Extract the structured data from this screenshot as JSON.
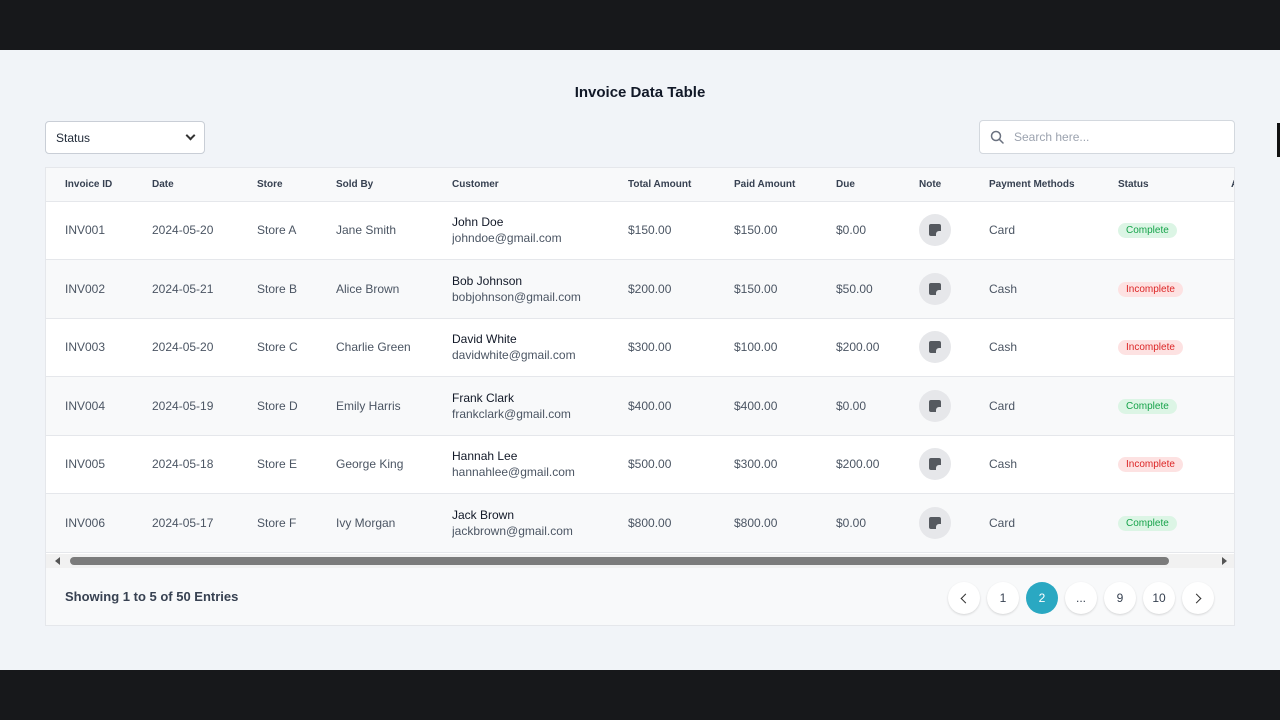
{
  "page": {
    "title": "Invoice Data Table"
  },
  "filters": {
    "status_select": "Status",
    "search_placeholder": "Search here..."
  },
  "table": {
    "columns": [
      "Invoice ID",
      "Date",
      "Store",
      "Sold By",
      "Customer",
      "Total Amount",
      "Paid Amount",
      "Due",
      "Note",
      "Payment Methods",
      "Status",
      "A"
    ],
    "rows": [
      {
        "id": "INV001",
        "date": "2024-05-20",
        "store": "Store A",
        "sold_by": "Jane Smith",
        "customer_name": "John Doe",
        "customer_email": "johndoe@gmail.com",
        "total": "$150.00",
        "paid": "$150.00",
        "due": "$0.00",
        "method": "Card",
        "status": "Complete"
      },
      {
        "id": "INV002",
        "date": "2024-05-21",
        "store": "Store B",
        "sold_by": "Alice Brown",
        "customer_name": "Bob Johnson",
        "customer_email": "bobjohnson@gmail.com",
        "total": "$200.00",
        "paid": "$150.00",
        "due": "$50.00",
        "method": "Cash",
        "status": "Incomplete"
      },
      {
        "id": "INV003",
        "date": "2024-05-20",
        "store": "Store C",
        "sold_by": "Charlie Green",
        "customer_name": "David White",
        "customer_email": "davidwhite@gmail.com",
        "total": "$300.00",
        "paid": "$100.00",
        "due": "$200.00",
        "method": "Cash",
        "status": "Incomplete"
      },
      {
        "id": "INV004",
        "date": "2024-05-19",
        "store": "Store D",
        "sold_by": "Emily Harris",
        "customer_name": "Frank Clark",
        "customer_email": "frankclark@gmail.com",
        "total": "$400.00",
        "paid": "$400.00",
        "due": "$0.00",
        "method": "Card",
        "status": "Complete"
      },
      {
        "id": "INV005",
        "date": "2024-05-18",
        "store": "Store E",
        "sold_by": "George King",
        "customer_name": "Hannah Lee",
        "customer_email": "hannahlee@gmail.com",
        "total": "$500.00",
        "paid": "$300.00",
        "due": "$200.00",
        "method": "Cash",
        "status": "Incomplete"
      },
      {
        "id": "INV006",
        "date": "2024-05-17",
        "store": "Store F",
        "sold_by": "Ivy Morgan",
        "customer_name": "Jack Brown",
        "customer_email": "jackbrown@gmail.com",
        "total": "$800.00",
        "paid": "$800.00",
        "due": "$0.00",
        "method": "Card",
        "status": "Complete"
      }
    ]
  },
  "footer": {
    "entries_text": "Showing 1 to 5 of 50 Entries",
    "pages": [
      "1",
      "2",
      "...",
      "9",
      "10"
    ],
    "active_page": "2"
  },
  "colors": {
    "accent": "#2aa8c2",
    "complete_bg": "#dcf5e5",
    "complete_text": "#16a34a",
    "incomplete_bg": "#fde2e2",
    "incomplete_text": "#dc2626"
  }
}
